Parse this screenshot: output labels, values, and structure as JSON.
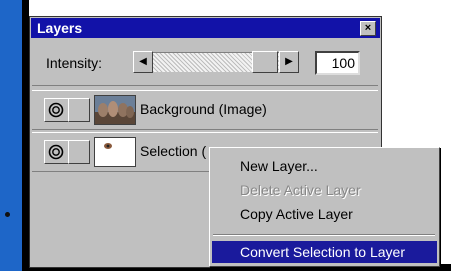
{
  "window": {
    "title": "Layers",
    "close_glyph": "×",
    "icons": {
      "close": "close-icon"
    }
  },
  "intensity": {
    "label": "Intensity:",
    "value": "100",
    "slider_fraction": 1.0,
    "left_arrow": "◀",
    "right_arrow": "▶"
  },
  "layers": [
    {
      "label": "Background (Image)",
      "visible": true
    },
    {
      "label": "Selection (",
      "visible": true
    }
  ],
  "context_menu": {
    "items": [
      {
        "label": "New Layer...",
        "enabled": true
      },
      {
        "label": "Delete Active Layer",
        "enabled": false
      },
      {
        "label": "Copy Active Layer",
        "enabled": true
      },
      {
        "label": "Convert Selection to Layer",
        "enabled": true,
        "selected": true
      }
    ]
  },
  "colors": {
    "titlebar": "#1212a8",
    "menu_highlight": "#1a1a9c",
    "background_frame": "#1e66c8"
  }
}
